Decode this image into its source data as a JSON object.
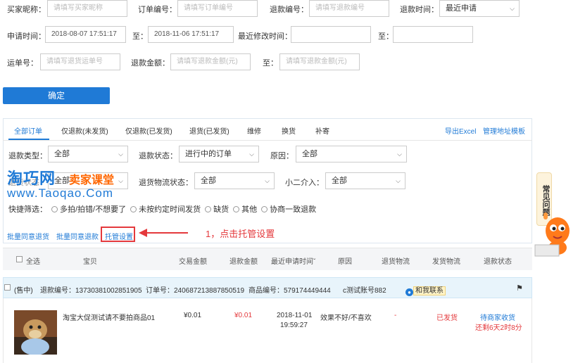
{
  "filters": {
    "buyer_nick": {
      "label": "买家昵称：",
      "placeholder": "请填写买家昵称"
    },
    "order_no": {
      "label": "订单编号：",
      "placeholder": "请填写订单编号"
    },
    "refund_no": {
      "label": "退款编号：",
      "placeholder": "请填写退款编号"
    },
    "refund_time": {
      "label": "退款时间：",
      "value": "最近申请"
    },
    "apply_time": {
      "label": "申请时间：",
      "from": "2018-08-07 17:51:17",
      "sep": "至：",
      "to": "2018-11-06 17:51:17"
    },
    "last_modified": {
      "label": "最近修改时间：",
      "from": "",
      "sep": "至：",
      "to": ""
    },
    "waybill": {
      "label": "运单号：",
      "placeholder": "请填写退货运单号"
    },
    "refund_amount": {
      "label": "退款金额：",
      "from_placeholder": "请填写退款金额(元)",
      "sep": "至：",
      "to_placeholder": "请填写退款金额(元)"
    },
    "confirm_label": "确定"
  },
  "tabs": [
    "全部订单",
    "仅退款(未发货)",
    "仅退款(已发货)",
    "退货(已发货)",
    "维修",
    "换货",
    "补寄"
  ],
  "top_links": {
    "export": "导出Excel",
    "address_template": "管理地址模板"
  },
  "dropdowns": {
    "refund_type": {
      "label": "退款类型：",
      "value": "全部"
    },
    "refund_status": {
      "label": "退款状态：",
      "value": "进行中的订单"
    },
    "reason": {
      "label": "原因：",
      "value": "全部"
    },
    "row2_first": {
      "label": "退货状态：",
      "value": "全部"
    },
    "return_logistics": {
      "label": "退货物流状态：",
      "value": "全部"
    },
    "xiaoer": {
      "label": "小二介入：",
      "value": "全部"
    }
  },
  "quick_filter": {
    "label": "快捷筛选：",
    "options": [
      "多拍/拍错/不想要了",
      "未按约定时间发货",
      "缺货",
      "其他",
      "协商一致退款"
    ]
  },
  "actions": {
    "batch_return": "批量同意退货",
    "batch_refund": "批量同意退款",
    "custody": "托管设置"
  },
  "annotation": "1，点击托管设置",
  "watermark": {
    "brand": "淘巧网",
    "sub": "卖家课堂",
    "url": "www.Taoqao.Com"
  },
  "faq": "常见问题",
  "table": {
    "headers": [
      "全选",
      "宝贝",
      "交易金额",
      "退款金额",
      "最近申请时间",
      "原因",
      "退货物流",
      "发货物流",
      "退款状态"
    ],
    "sort_icon": "chevron-down-icon"
  },
  "order": {
    "status_tag": "(售中)",
    "refund_no": "退款编号：13730381002851905",
    "order_no": "订单号：240687213887850519",
    "item_no": "商品编号：579174449444",
    "account": "c测试账号882",
    "contact": "和我联系"
  },
  "row": {
    "title": "淘宝大促测试请不要拍商品01",
    "trade_amount": "¥0.01",
    "refund_amount": "¥0.01",
    "date": "2018-11-01",
    "time": "19:59:27",
    "reason": "效果不好/不喜欢",
    "return_logistics": "-",
    "ship_logistics": "已发货",
    "status": "待商家收货",
    "countdown": "还剩6天2时8分"
  },
  "colors": {
    "accent": "#1f7ad6",
    "red": "#e4393c",
    "annotation": "#e4393c",
    "brand_blue": "#1f7ad6",
    "brand_orange": "#ff6600"
  }
}
